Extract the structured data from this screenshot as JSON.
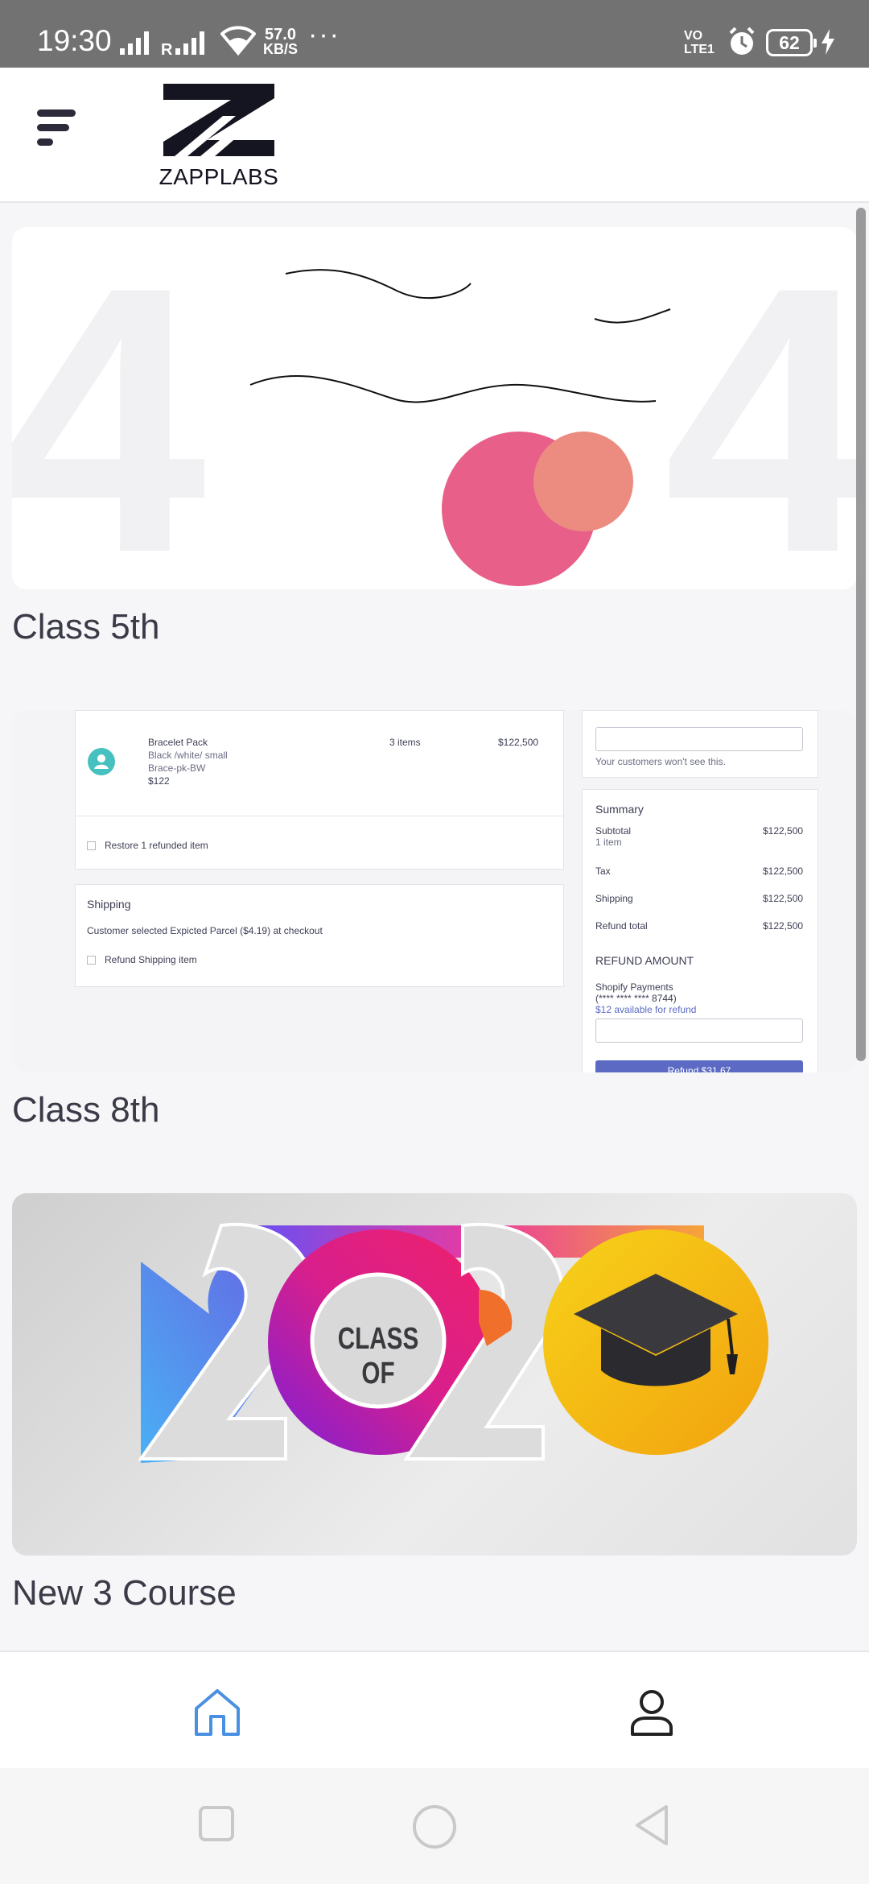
{
  "status_bar": {
    "time": "19:30",
    "net_speed_value": "57.0",
    "net_speed_unit": "KB/S",
    "overflow": "···",
    "volte_top": "VO",
    "volte_bottom": "LTE1",
    "battery": "62",
    "icons": [
      "signal-icon",
      "signal-roaming-icon",
      "wifi-icon",
      "alarm-icon",
      "charging-icon"
    ]
  },
  "app_bar": {
    "logo_text": "ZAPPLABS",
    "menu_icon": "menu-icon"
  },
  "courses": [
    {
      "title": "Class 5th",
      "image": "404-illustration"
    },
    {
      "title": "Class 8th",
      "image": "refund-screenshot"
    },
    {
      "title": "New 3 Course",
      "image": "class-of-2020"
    }
  ],
  "refund_screenshot": {
    "product_name": "Bracelet Pack",
    "product_variant": "Black /white/ small",
    "product_sku": "Brace-pk-BW",
    "product_price": "$122",
    "items_count": "3 items",
    "item_total": "$122,500",
    "restore_label": "Restore 1 refunded item",
    "shipping_heading": "Shipping",
    "shipping_text": "Customer selected Expicted Parcel ($4.19) at checkout",
    "refund_shipping_label": "Refund Shipping item",
    "note_hint": "Your customers won't see this.",
    "summary_heading": "Summary",
    "summary_rows": [
      {
        "label": "Subtotal",
        "sub": "1 item",
        "value": "$122,500"
      },
      {
        "label": "Tax",
        "sub": "",
        "value": "$122,500"
      },
      {
        "label": "Shipping",
        "sub": "",
        "value": "$122,500"
      },
      {
        "label": "Refund total",
        "sub": "",
        "value": "$122,500"
      }
    ],
    "refund_amount_heading": "REFUND AMOUNT",
    "payment_method": "Shopify Payments",
    "card_mask": "(**** **** **** 8744)",
    "available": "$12 available for refund",
    "refund_button": "Refund $31.67"
  },
  "class_of_2020": {
    "badge_text": "CLASS OF"
  },
  "bottom_nav": {
    "items": [
      {
        "name": "home",
        "icon": "home-icon",
        "active": true
      },
      {
        "name": "profile",
        "icon": "person-icon",
        "active": false
      }
    ]
  },
  "colors": {
    "active_nav": "#4a90e2",
    "title_text": "#3a3b47",
    "status_bar": "#727272",
    "circle_pink": "#e8608a",
    "circle_salmon": "#ec8b80"
  }
}
